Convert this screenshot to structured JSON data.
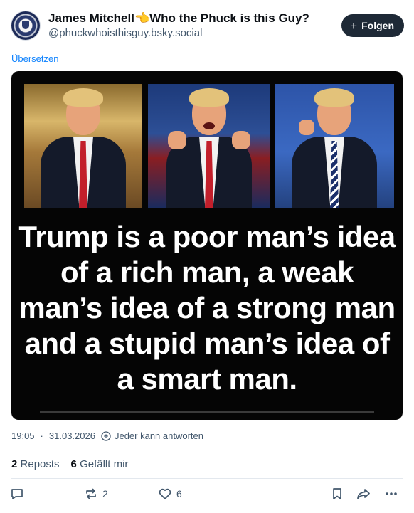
{
  "author": {
    "display_name": "James Mitchell👈Who the Phuck is this Guy?",
    "handle": "@phuckwhoisthisguy.bsky.social",
    "avatar_icon": "seal-avatar-icon"
  },
  "follow": {
    "label": "Folgen",
    "icon": "plus-icon"
  },
  "translate_label": "Übersetzen",
  "image": {
    "text": "Trump is a poor man’s idea of a rich man, a weak man’s idea of a strong man and a stupid man’s idea of a smart man."
  },
  "meta": {
    "time": "19:05",
    "separator": "·",
    "date": "31.03.2026",
    "reply_setting": "Jeder kann antworten"
  },
  "stats": {
    "reposts_count": "2",
    "reposts_label": "Reposts",
    "likes_count": "6",
    "likes_label": "Gefällt mir"
  },
  "actions": {
    "reply_icon": "reply-icon",
    "repost_icon": "repost-icon",
    "repost_count": "2",
    "like_icon": "heart-icon",
    "like_count": "6",
    "bookmark_icon": "bookmark-icon",
    "share_icon": "share-icon",
    "more_icon": "more-icon"
  },
  "colors": {
    "accent": "#1083fe",
    "button_bg": "#1e2936",
    "muted_text": "#42576c"
  }
}
